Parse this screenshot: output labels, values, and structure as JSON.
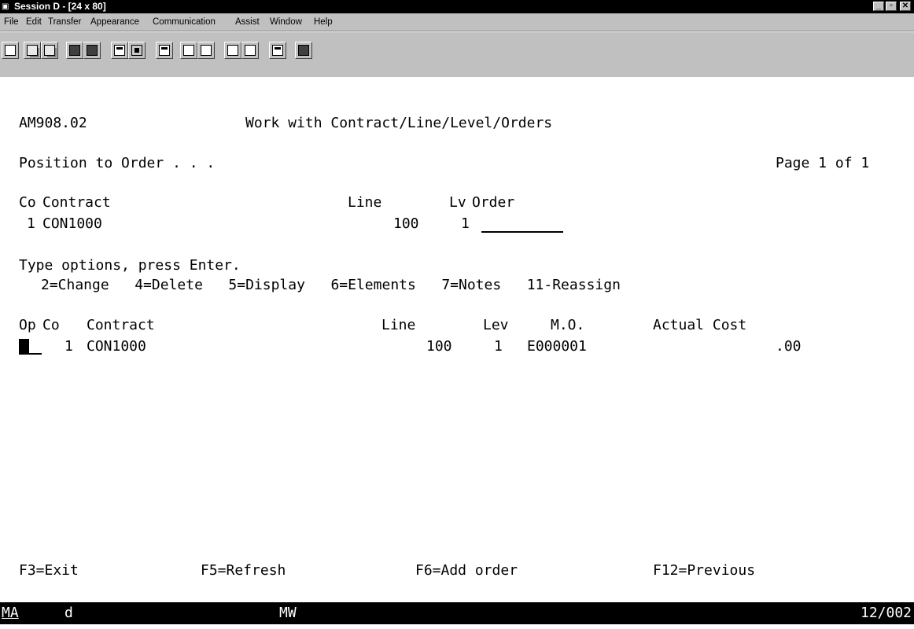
{
  "window": {
    "title": "Session D - [24 x 80]",
    "minimize_glyph": "_",
    "maximize_glyph": "▫",
    "close_glyph": "✕"
  },
  "menu": {
    "file": "File",
    "edit": "Edit",
    "transfer": "Transfer",
    "appearance": "Appearance",
    "communication": "Communication",
    "assist": "Assist",
    "window": "Window",
    "help": "Help"
  },
  "toolbar": {
    "icons": [
      "screen-icon",
      "copy-icon",
      "paste-icon",
      "send-file-icon",
      "receive-file-icon",
      "keypad-icon",
      "display-icon",
      "macro-icon",
      "record-icon",
      "play-icon",
      "start-icon",
      "stop-icon",
      "clipboard-icon",
      "exit-icon"
    ]
  },
  "screen": {
    "program_id": "AM908.02",
    "title": "Work with Contract/Line/Level/Orders",
    "position_label": "Position to Order . . .",
    "page_info": "Page 1 of 1",
    "header1": {
      "co": "Co",
      "contract": "Contract",
      "line": "Line",
      "lv": "Lv",
      "order": "Order"
    },
    "header1_values": {
      "co": "1",
      "contract": "CON1000",
      "line": "100",
      "lv": "1",
      "order": ""
    },
    "instructions": "Type options, press Enter.",
    "options": "2=Change   4=Delete   5=Display   6=Elements   7=Notes   11-Reassign",
    "columns": {
      "op": "Op",
      "co": "Co",
      "contract": "Contract",
      "line": "Line",
      "lev": "Lev",
      "mo": "M.O.",
      "actual_cost": "Actual Cost"
    },
    "rows": [
      {
        "op": "",
        "co": "1",
        "contract": "CON1000",
        "line": "100",
        "lev": "1",
        "mo": "E000001",
        "actual_cost": ".00"
      }
    ],
    "function_keys": {
      "f3": "F3=Exit",
      "f5": "F5=Refresh",
      "f6": "F6=Add order",
      "f12": "F12=Previous"
    }
  },
  "status": {
    "mode": "MA",
    "session": "d",
    "indicator": "MW",
    "cursor_pos": "12/002"
  }
}
